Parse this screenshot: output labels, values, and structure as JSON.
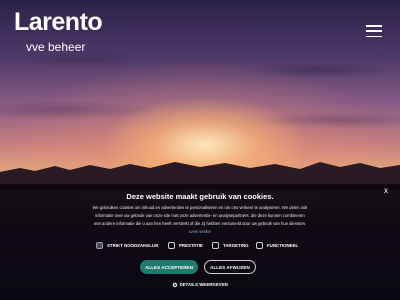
{
  "header": {
    "logo_text": "Larento",
    "tagline": "vve beheer",
    "menu_icon": "hamburger-icon"
  },
  "cookie_banner": {
    "close_label": "x",
    "title": "Deze website maakt gebruik van cookies.",
    "body_text": "We gebruiken cookies om inhoud en advertenties te personaliseren en om ons verkeer te analyseren. We delen ook informatie over uw gebruik van onze site met onze advertentie- en analysepartners, die deze kunnen combineren met andere informatie die u aan hen heeft verstrekt of die zij hebben verzameld door uw gebruik van hun diensten.",
    "read_more_label": "Lees verder",
    "options": [
      {
        "label": "STRIKT NOODZAKELIJK",
        "checked": true
      },
      {
        "label": "PRESTATIE",
        "checked": false
      },
      {
        "label": "TARGETING",
        "checked": false
      },
      {
        "label": "FUNCTIONEEL",
        "checked": false
      }
    ],
    "accept_label": "ALLES ACCEPTEREN",
    "reject_label": "ALLES AFWIJZEN",
    "details_label": "DETAILS WEERGEVEN",
    "details_icon": "gear-icon",
    "accept_color": "#1f7a70"
  }
}
